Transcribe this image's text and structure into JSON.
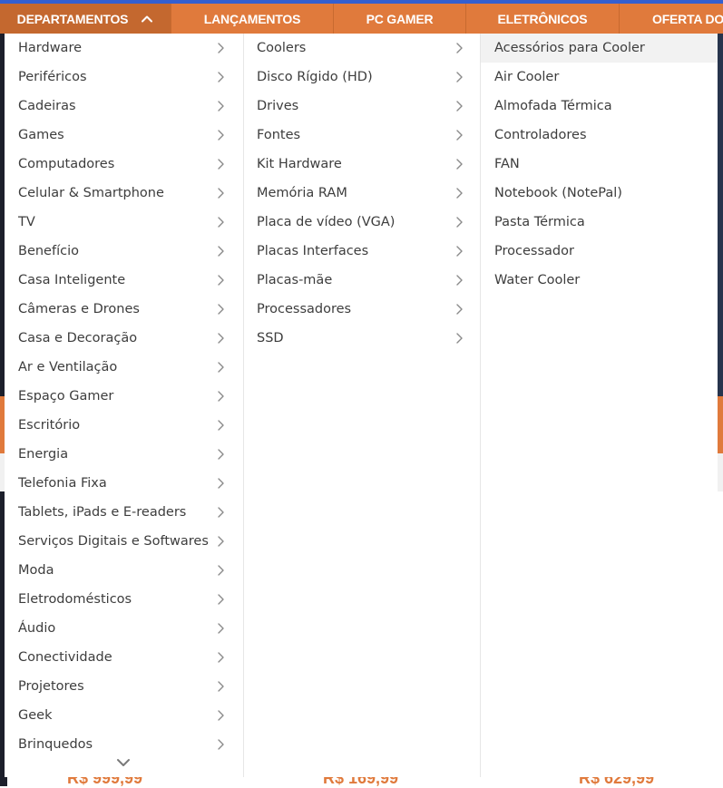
{
  "nav": {
    "items": [
      {
        "label": "DEPARTAMENTOS"
      },
      {
        "label": "LANÇAMENTOS"
      },
      {
        "label": "PC GAMER"
      },
      {
        "label": "ELETRÔNICOS"
      },
      {
        "label": "OFERTA DO"
      }
    ]
  },
  "menu": {
    "departments": [
      "Hardware",
      "Periféricos",
      "Cadeiras",
      "Games",
      "Computadores",
      "Celular & Smartphone",
      "TV",
      "Benefício",
      "Casa Inteligente",
      "Câmeras e Drones",
      "Casa e Decoração",
      "Ar e Ventilação",
      "Espaço Gamer",
      "Escritório",
      "Energia",
      "Telefonia Fixa",
      "Tablets, iPads e E-readers",
      "Serviços Digitais e Softwares",
      "Moda",
      "Eletrodomésticos",
      "Áudio",
      "Conectividade",
      "Projetores",
      "Geek",
      "Brinquedos"
    ],
    "hardware": [
      "Coolers",
      "Disco Rígido (HD)",
      "Drives",
      "Fontes",
      "Kit Hardware",
      "Memória RAM",
      "Placa de vídeo (VGA)",
      "Placas Interfaces",
      "Placas-mãe",
      "Processadores",
      "SSD"
    ],
    "coolers": [
      "Acessórios para Cooler",
      "Air Cooler",
      "Almofada Térmica",
      "Controladores",
      "FAN",
      "Notebook (NotePal)",
      "Pasta Térmica",
      "Processador",
      "Water Cooler"
    ]
  },
  "background": {
    "prices": [
      "R$ 999,99",
      "R$ 169,99",
      "R$ 629,99"
    ]
  },
  "colors": {
    "nav_bg": "#e07a3c",
    "nav_active": "#c4682f",
    "nav_top_border": "#345fd0",
    "menu_text": "#3d3d3d",
    "active_item_bg": "#f2f2f2"
  }
}
